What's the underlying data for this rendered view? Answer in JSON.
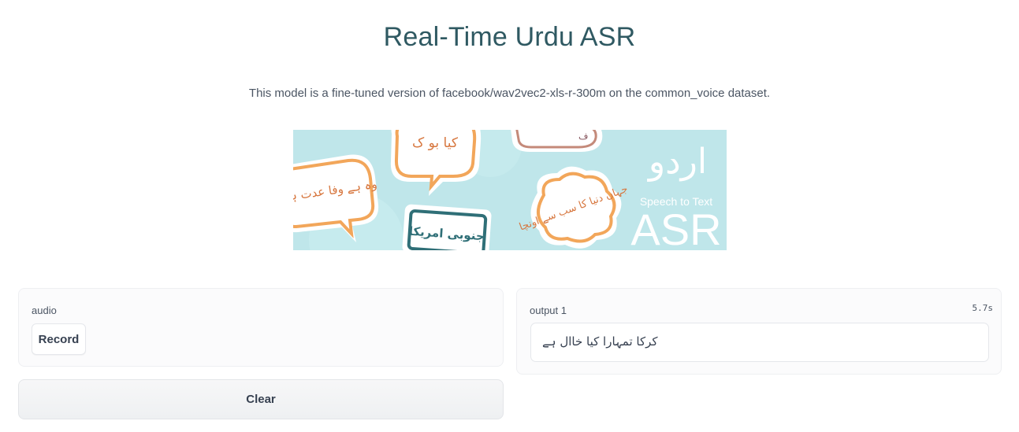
{
  "header": {
    "title": "Real-Time Urdu ASR",
    "description": "This model is a fine-tuned version of facebook/wav2vec2-xls-r-300m on the common_voice dataset."
  },
  "banner": {
    "logo_urdu": "اردو",
    "logo_subtitle": "Speech to Text",
    "logo_main": "ASR",
    "bubbles": [
      "کیا بو ک",
      "وہ ہے وفا عدت ہو",
      "جنوبی امریکا",
      "جہاں دنیا کا سب سے اونچا"
    ]
  },
  "input_panel": {
    "label": "audio",
    "record_label": "Record"
  },
  "output_panel": {
    "label": "output 1",
    "timer": "5.7s",
    "text": "کرکا تمہارا کیا خاال ہے"
  },
  "actions": {
    "clear_label": "Clear"
  },
  "colors": {
    "title": "#2f5962",
    "banner_bg": "#b6e2e6",
    "bubble_orange": "#f2a65a",
    "bubble_teal": "#2f6f77"
  }
}
